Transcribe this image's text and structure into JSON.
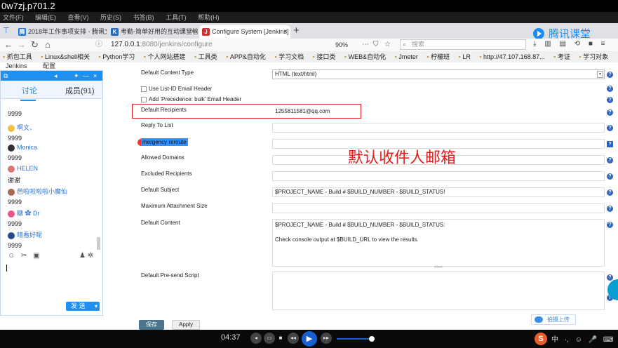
{
  "window": {
    "title": "0w7zj.p701.2"
  },
  "menu": [
    "文件(F)",
    "编辑(E)",
    "查看(V)",
    "历史(S)",
    "书签(B)",
    "工具(T)",
    "帮助(H)"
  ],
  "tabs": [
    {
      "label": "2018年工作事项安排 - 腾讯文档",
      "favicon": "腾",
      "color": "#1e6fd9"
    },
    {
      "label": "考勤-简单好用的互动课堂管理",
      "favicon": "K",
      "color": "#2b6cb0"
    },
    {
      "label": "Configure System [Jenkins]",
      "favicon": "J",
      "color": "#c33"
    }
  ],
  "nav": {
    "url_host": "127.0.0.1",
    "url_path": ":8080/jenkins/configure",
    "zoom": "90%",
    "search_placeholder": "搜索"
  },
  "brand": {
    "name": "腾讯课堂"
  },
  "bookmarks": [
    "抓包工具",
    "Linux&shell相关",
    "Python学习",
    "个人网站搭建",
    "工具类",
    "APP&自动化",
    "学习文档",
    "接口类",
    "WEB&自动化",
    "Jmeter",
    "柠檬班",
    "LR",
    "http://47.107.168.87...",
    "考证",
    "学习对象"
  ],
  "breadcrumb": [
    "Jenkins",
    "配置"
  ],
  "chat": {
    "tab_discuss": "讨论",
    "tab_members": "成员(91)",
    "messages": [
      {
        "nick": "",
        "text": "9999"
      },
      {
        "nick": "啊文、",
        "text": "9999"
      },
      {
        "nick": "Monica",
        "text": "9999"
      },
      {
        "nick": "HELEN",
        "text": "谢谢"
      },
      {
        "nick": "芭啦啦啦啦小魔仙",
        "text": "9999"
      },
      {
        "nick": "糖 ✿ Dr",
        "text": "9999"
      },
      {
        "nick": "晴看好呢",
        "text": "9999"
      }
    ],
    "send_label": "发 送"
  },
  "form": {
    "content_type_label": "Default Content Type",
    "content_type_value": "HTML (text/html)",
    "list_id_label": "Use List-ID Email Header",
    "precedence_label": "Add 'Precedence: bulk' Email Header",
    "recipients_label": "Default Recipients",
    "recipients_value": "1255811581@qq.com",
    "reply_to_label": "Reply To List",
    "emergency_label": "mergency reroute",
    "allowed_domains_label": "Allowed Domains",
    "excluded_label": "Excluded Recipients",
    "subject_label": "Default Subject",
    "subject_value": "$PROJECT_NAME - Build # $BUILD_NUMBER - $BUILD_STATUS!",
    "max_attach_label": "Maximum Attachment Size",
    "content_label": "Default Content",
    "content_line1": "$PROJECT_NAME - Build # $BUILD_NUMBER - $BUILD_STATUS:",
    "content_line2": "Check console output at $BUILD_URL to view the results.",
    "presend_label": "Default Pre-send Script",
    "save_label": "保存",
    "apply_label": "Apply",
    "upload_label": "拍摄上传"
  },
  "annotation": "默认收件人邮箱",
  "player": {
    "time": "04:37"
  },
  "ime": [
    "中",
    "·,",
    "☺",
    "🎤",
    "⌨",
    "👕",
    "⁝⁝"
  ]
}
